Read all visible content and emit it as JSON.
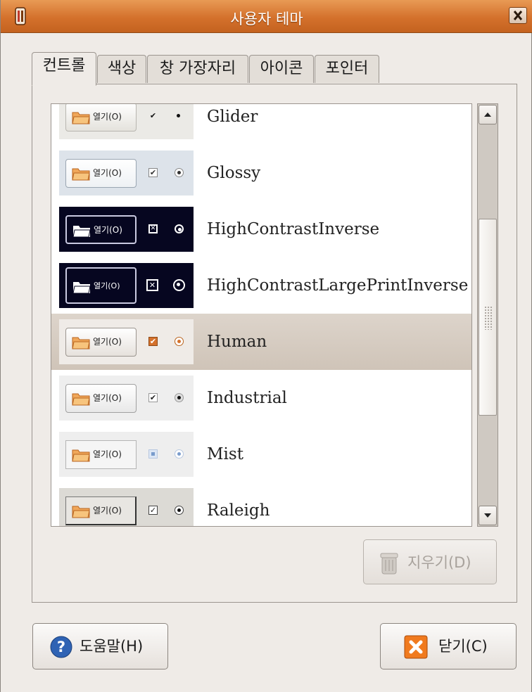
{
  "window": {
    "title": "사용자 테마",
    "close_label": "X"
  },
  "tabs": [
    {
      "label": "컨트롤",
      "active": true
    },
    {
      "label": "색상",
      "active": false
    },
    {
      "label": "창 가장자리",
      "active": false
    },
    {
      "label": "아이콘",
      "active": false
    },
    {
      "label": "포인터",
      "active": false
    }
  ],
  "preview_button_label": "열기(O)",
  "themes": [
    {
      "name": "Glider",
      "style": "glider"
    },
    {
      "name": "Glossy",
      "style": "glossy"
    },
    {
      "name": "HighContrastInverse",
      "style": "hci"
    },
    {
      "name": "HighContrastLargePrintInverse",
      "style": "hclpi"
    },
    {
      "name": "Human",
      "style": "human",
      "selected": true
    },
    {
      "name": "Industrial",
      "style": "industrial"
    },
    {
      "name": "Mist",
      "style": "mist"
    },
    {
      "name": "Raleigh",
      "style": "raleigh"
    }
  ],
  "scrollbar": {
    "up_icon": "arrow-up-icon",
    "down_icon": "arrow-down-icon"
  },
  "buttons": {
    "delete": {
      "label": "지우기(D)",
      "enabled": false,
      "icon": "trash-icon"
    },
    "help": {
      "label": "도움말(H)",
      "icon": "help-icon"
    },
    "close": {
      "label": "닫기(C)",
      "icon": "close-icon"
    }
  },
  "colors": {
    "accent": "#d4712c",
    "selection": "#d6ccc1",
    "high_contrast_bg": "#060620"
  }
}
